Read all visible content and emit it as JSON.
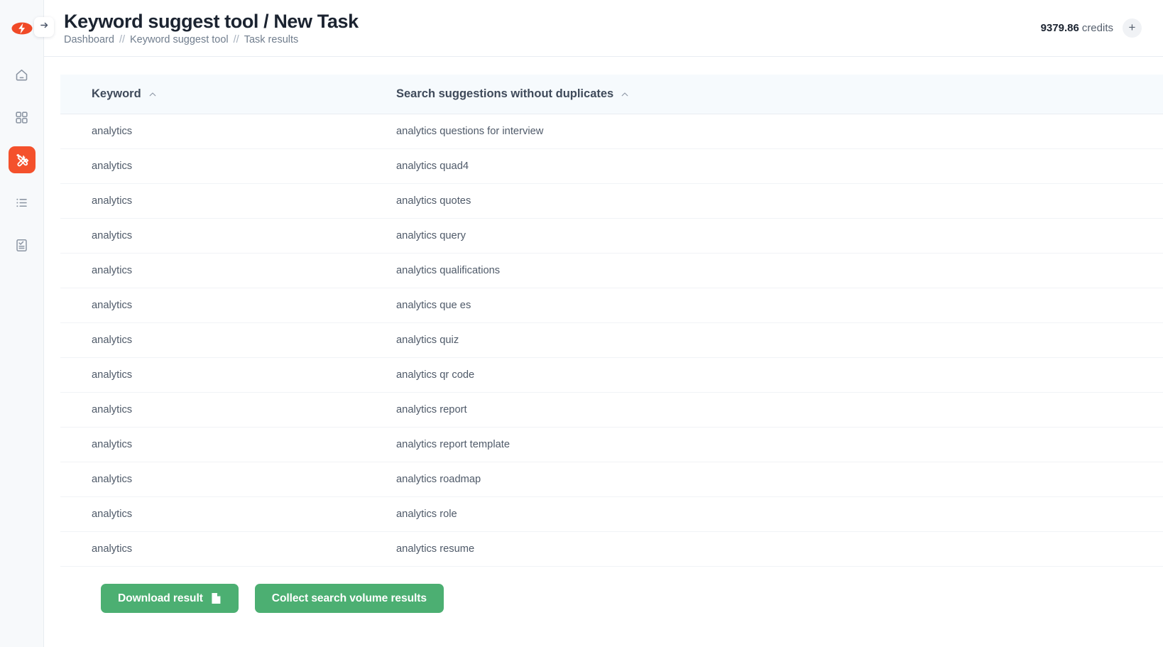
{
  "brand": {
    "logo_icon": "bolt-eye-logo-icon",
    "accent_color": "#f4512c"
  },
  "sidebar": {
    "collapse_toggle_icon": "arrow-right-icon",
    "items": [
      {
        "name": "home",
        "icon": "home-icon",
        "active": false
      },
      {
        "name": "apps",
        "icon": "grid-apps-icon",
        "active": false
      },
      {
        "name": "tools",
        "icon": "tools-icon",
        "active": true
      },
      {
        "name": "lists",
        "icon": "list-icon",
        "active": false
      },
      {
        "name": "reports",
        "icon": "report-check-icon",
        "active": false
      }
    ]
  },
  "header": {
    "title": "Keyword suggest tool / New Task",
    "breadcrumb": [
      {
        "label": "Dashboard",
        "current": false
      },
      {
        "label": "Keyword suggest tool",
        "current": false
      },
      {
        "label": "Task results",
        "current": true
      }
    ],
    "breadcrumb_separator": "//",
    "credits": {
      "amount": "9379.86",
      "label": "credits",
      "add_button_icon": "plus-icon",
      "add_button_label": "+"
    }
  },
  "table": {
    "columns": [
      {
        "key": "keyword",
        "label": "Keyword",
        "sort": "asc",
        "sort_icon": "chevron-up-icon"
      },
      {
        "key": "suggestion",
        "label": "Search suggestions without duplicates",
        "sort": "asc",
        "sort_icon": "chevron-up-icon"
      }
    ],
    "rows": [
      {
        "keyword": "analytics",
        "suggestion": "analytics questions for interview"
      },
      {
        "keyword": "analytics",
        "suggestion": "analytics quad4"
      },
      {
        "keyword": "analytics",
        "suggestion": "analytics quotes"
      },
      {
        "keyword": "analytics",
        "suggestion": "analytics query"
      },
      {
        "keyword": "analytics",
        "suggestion": "analytics qualifications"
      },
      {
        "keyword": "analytics",
        "suggestion": "analytics que es"
      },
      {
        "keyword": "analytics",
        "suggestion": "analytics quiz"
      },
      {
        "keyword": "analytics",
        "suggestion": "analytics qr code"
      },
      {
        "keyword": "analytics",
        "suggestion": "analytics report"
      },
      {
        "keyword": "analytics",
        "suggestion": "analytics report template"
      },
      {
        "keyword": "analytics",
        "suggestion": "analytics roadmap"
      },
      {
        "keyword": "analytics",
        "suggestion": "analytics role"
      },
      {
        "keyword": "analytics",
        "suggestion": "analytics resume"
      }
    ]
  },
  "footer": {
    "download_label": "Download result",
    "download_icon": "document-icon",
    "collect_label": "Collect search volume results",
    "button_color": "#4caf72"
  }
}
